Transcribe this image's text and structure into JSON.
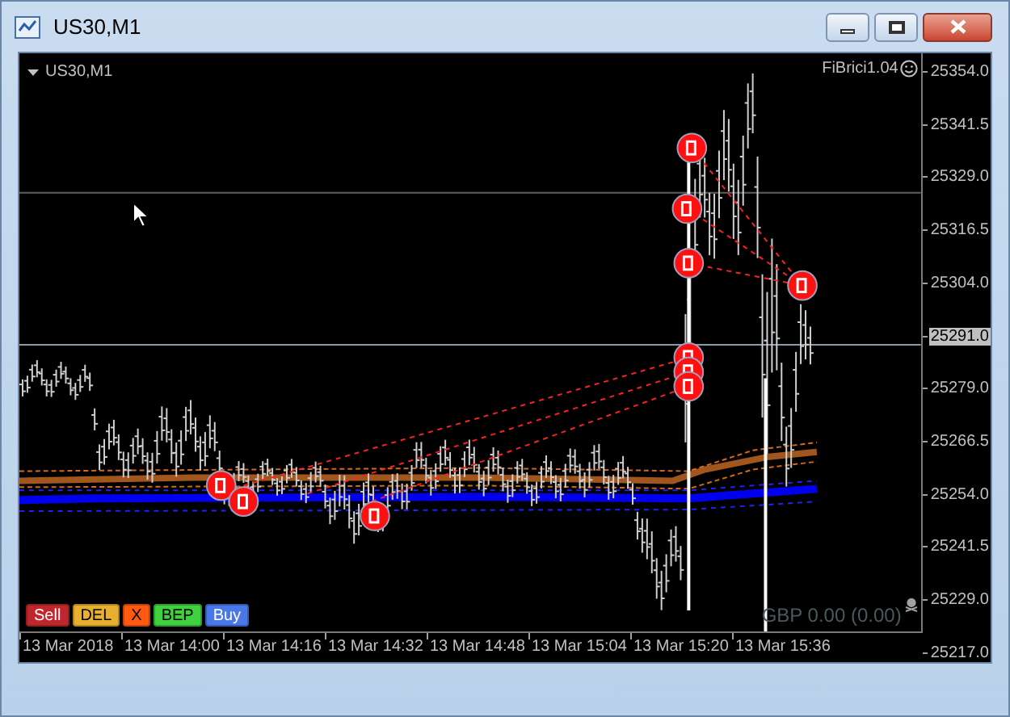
{
  "window": {
    "title": "US30,M1"
  },
  "chart": {
    "symbol_label": "US30,M1",
    "indicator": "FiBrici1.04",
    "account": "GBP 0.00 (0.00)"
  },
  "trade_buttons": [
    {
      "label": "Sell",
      "color": "#c0272d"
    },
    {
      "label": "DEL",
      "color": "#e8b030"
    },
    {
      "label": "X",
      "color": "#ff5a10"
    },
    {
      "label": "BEP",
      "color": "#40d040"
    },
    {
      "label": "Buy",
      "color": "#4a78e8"
    }
  ],
  "price_axis": [
    {
      "label": "25354.0",
      "current": false
    },
    {
      "label": "25341.5",
      "current": false
    },
    {
      "label": "25329.0",
      "current": false
    },
    {
      "label": "25316.5",
      "current": false
    },
    {
      "label": "25304.0",
      "current": false
    },
    {
      "label": "25291.0",
      "current": true
    },
    {
      "label": "25279.0",
      "current": false
    },
    {
      "label": "25266.5",
      "current": false
    },
    {
      "label": "25254.0",
      "current": false
    },
    {
      "label": "25241.5",
      "current": false
    },
    {
      "label": "25229.0",
      "current": false
    },
    {
      "label": "25217.0",
      "current": false
    }
  ],
  "time_axis": [
    "13 Mar 2018",
    "13 Mar 14:00",
    "13 Mar 14:16",
    "13 Mar 14:32",
    "13 Mar 14:48",
    "13 Mar 15:04",
    "13 Mar 15:20",
    "13 Mar 15:36"
  ]
}
